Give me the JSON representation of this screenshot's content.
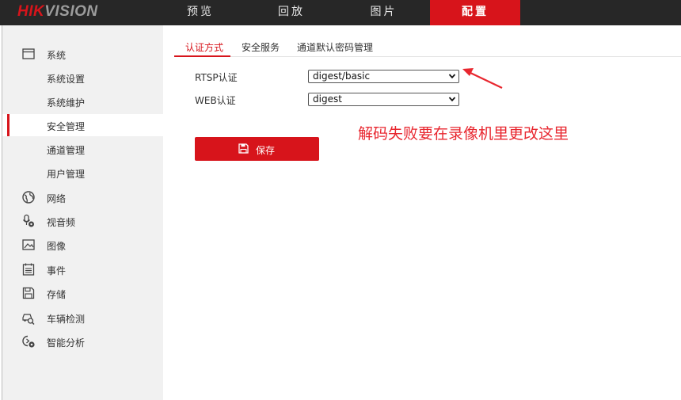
{
  "logo": {
    "brand_red": "HIK",
    "brand_grey": "VISION"
  },
  "nav": [
    {
      "label": "预览"
    },
    {
      "label": "回放"
    },
    {
      "label": "图片"
    },
    {
      "label": "配置",
      "active": true
    }
  ],
  "sidebar": {
    "groups": [
      {
        "label": "系统",
        "icon": "window-icon"
      },
      {
        "label": "网络",
        "icon": "globe-icon"
      },
      {
        "label": "视音频",
        "icon": "microphone-gear-icon"
      },
      {
        "label": "图像",
        "icon": "image-icon"
      },
      {
        "label": "事件",
        "icon": "calendar-icon"
      },
      {
        "label": "存储",
        "icon": "floppy-disk-icon"
      },
      {
        "label": "车辆检测",
        "icon": "vehicle-search-icon"
      },
      {
        "label": "智能分析",
        "icon": "smart-analysis-icon"
      }
    ],
    "system_items": [
      {
        "label": "系统设置"
      },
      {
        "label": "系统维护"
      },
      {
        "label": "安全管理",
        "active": true
      },
      {
        "label": "通道管理"
      },
      {
        "label": "用户管理"
      }
    ]
  },
  "tabs": [
    {
      "label": "认证方式",
      "active": true
    },
    {
      "label": "安全服务"
    },
    {
      "label": "通道默认密码管理"
    }
  ],
  "form": {
    "rtsp_label": "RTSP认证",
    "rtsp_value": "digest/basic",
    "web_label": "WEB认证",
    "web_value": "digest",
    "save_label": "保存"
  },
  "annotation": {
    "text": "解码失败要在录像机里更改这里"
  },
  "colors": {
    "accent": "#d7141b",
    "topbar": "#272727",
    "sidebar": "#f1f1f1",
    "annotation": "#e8272f"
  }
}
